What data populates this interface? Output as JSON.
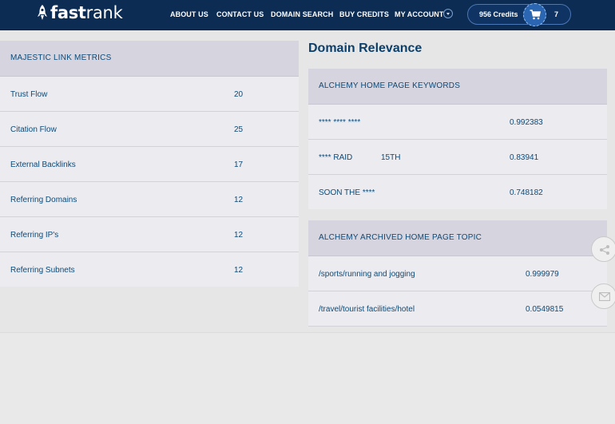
{
  "nav": {
    "brand_bold": "fast",
    "brand_light": "rank",
    "menu": [
      "ABOUT US",
      "CONTACT US",
      "DOMAIN SEARCH",
      "BUY CREDITS",
      "MY ACCOUNT"
    ],
    "credits": "956 Credits",
    "cart_count": "7"
  },
  "majestic": {
    "header": "MAJESTIC LINK METRICS",
    "rows": [
      {
        "label": "Trust Flow",
        "value": "20"
      },
      {
        "label": "Citation Flow",
        "value": "25"
      },
      {
        "label": "External Backlinks",
        "value": "17"
      },
      {
        "label": "Referring Domains",
        "value": "12"
      },
      {
        "label": "Referring IP's",
        "value": "12"
      },
      {
        "label": "Referring Subnets",
        "value": "12"
      }
    ]
  },
  "relevance": {
    "title": "Domain Relevance",
    "keywords": {
      "header": "ALCHEMY HOME PAGE KEYWORDS",
      "rows": [
        {
          "a": "**** **** ****",
          "b": "",
          "score": "0.992383"
        },
        {
          "a": "**** RAID",
          "b": "15TH",
          "score": "0.83941"
        },
        {
          "a": "SOON THE ****",
          "b": "",
          "score": "0.748182"
        }
      ]
    },
    "topics": {
      "header": "ALCHEMY ARCHIVED HOME PAGE TOPIC",
      "rows": [
        {
          "topic": "/sports/running and jogging",
          "score": "0.999979"
        },
        {
          "topic": "/travel/tourist facilities/hotel",
          "score": "0.0549815"
        }
      ]
    }
  },
  "side_icons": [
    "share-icon",
    "mail-icon"
  ],
  "colors": {
    "nav_bg": "#0d2c54",
    "text_blue": "#0d4a78",
    "header_bg": "#d6d4de",
    "cart_bg": "#2a66b2"
  }
}
